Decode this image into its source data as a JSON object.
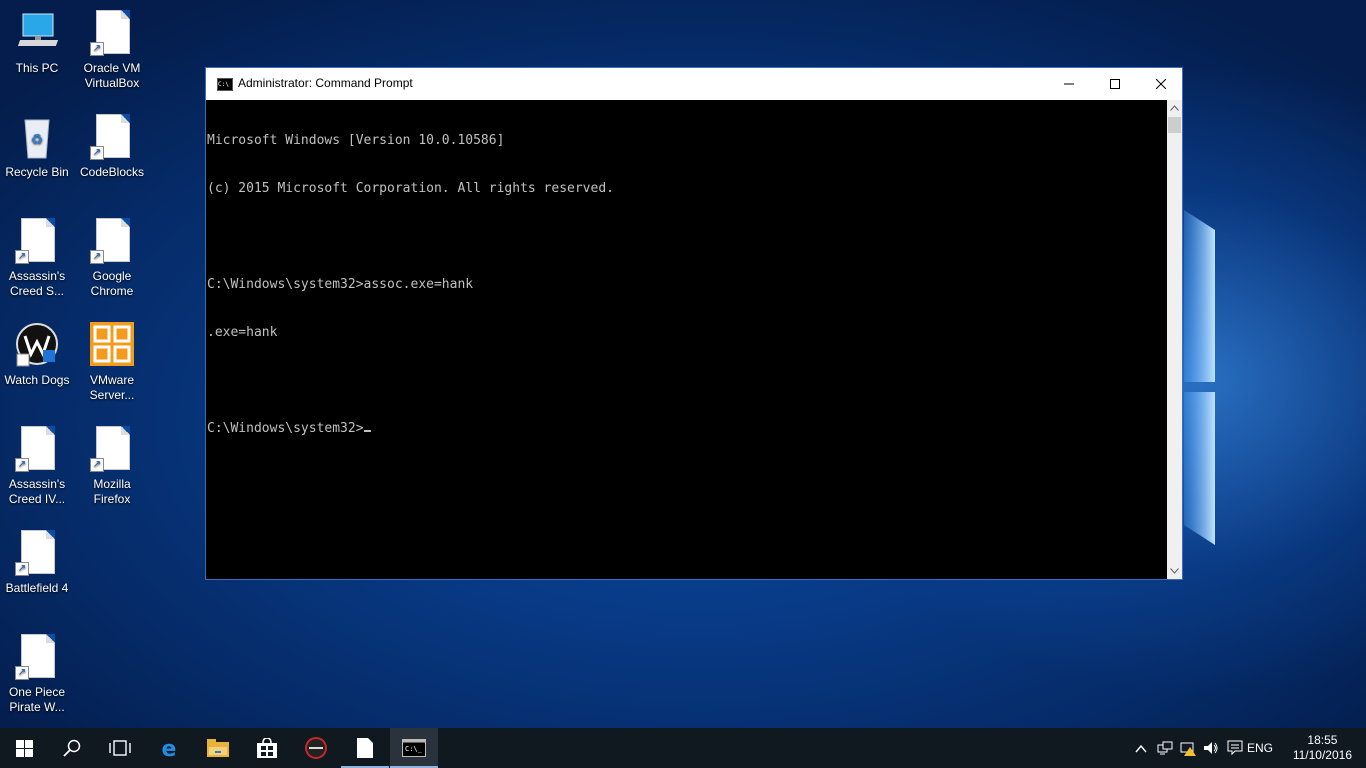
{
  "desktop": {
    "icons": [
      {
        "label": "This PC",
        "icon": "computer-icon"
      },
      {
        "label": "Oracle VM VirtualBox",
        "icon": "document-shortcut-icon"
      },
      {
        "label": "Recycle Bin",
        "icon": "recycle-bin-icon"
      },
      {
        "label": "CodeBlocks",
        "icon": "document-shortcut-icon"
      },
      {
        "label": "Assassin's Creed S...",
        "icon": "document-shortcut-icon"
      },
      {
        "label": "Google Chrome",
        "icon": "document-shortcut-icon"
      },
      {
        "label": "Watch Dogs",
        "icon": "watch-dogs-icon"
      },
      {
        "label": "VMware Server...",
        "icon": "vmware-icon"
      },
      {
        "label": "Assassin's Creed IV...",
        "icon": "document-shortcut-icon"
      },
      {
        "label": "Mozilla Firefox",
        "icon": "document-shortcut-icon"
      },
      {
        "label": "Battlefield 4",
        "icon": "document-shortcut-icon"
      },
      {
        "label": "One Piece Pirate W...",
        "icon": "document-shortcut-icon"
      }
    ]
  },
  "window": {
    "title": "Administrator: Command Prompt",
    "console_lines": [
      "Microsoft Windows [Version 10.0.10586]",
      "(c) 2015 Microsoft Corporation. All rights reserved.",
      "",
      "C:\\Windows\\system32>assoc.exe=hank",
      ".exe=hank",
      "",
      "C:\\Windows\\system32>"
    ]
  },
  "taskbar": {
    "items": [
      "start-icon",
      "search-icon",
      "task-view-icon",
      "edge-icon",
      "file-explorer-icon",
      "store-icon",
      "asus-icon",
      "document-icon",
      "command-prompt-icon"
    ],
    "tray": {
      "language": "ENG",
      "time": "18:55",
      "date": "11/10/2016"
    }
  },
  "colors": {
    "console_bg": "#000000",
    "console_text": "#c0c0c0",
    "taskbar_bg": "#101820",
    "desktop_accent": "#0b4ea8"
  }
}
